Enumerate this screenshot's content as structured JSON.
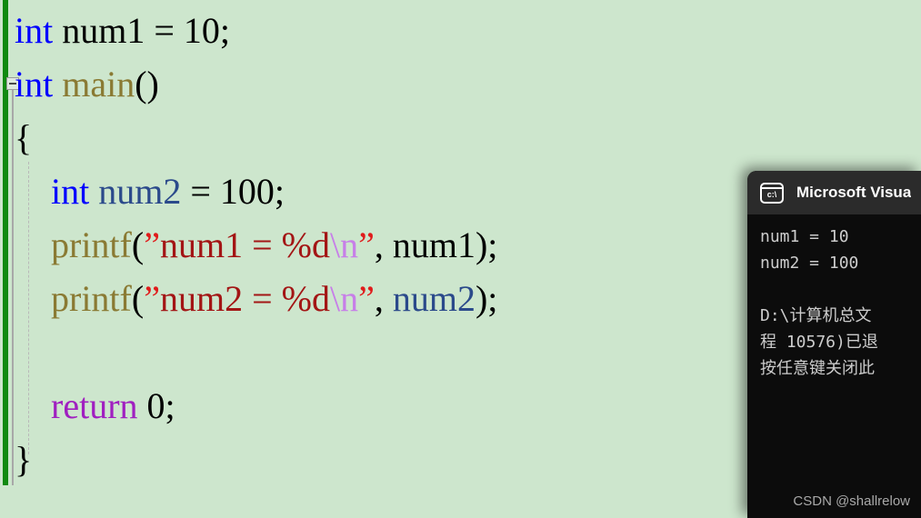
{
  "editor": {
    "background_color": "#cde6cd",
    "change_bar_color": "#108a10",
    "collapse_box": "collapse-outlining-box",
    "code_lines": [
      {
        "index": 1,
        "text": "int num1 = 10;",
        "tokens": [
          {
            "t": "int",
            "c": "kw"
          },
          {
            "t": " num1 = 10;",
            "c": "plain"
          }
        ]
      },
      {
        "index": 2,
        "text": "int main()",
        "tokens": [
          {
            "t": "int",
            "c": "kw"
          },
          {
            "t": " ",
            "c": "plain"
          },
          {
            "t": "main",
            "c": "fn"
          },
          {
            "t": "()",
            "c": "plain"
          }
        ]
      },
      {
        "index": 3,
        "text": "{",
        "tokens": [
          {
            "t": "{",
            "c": "plain"
          }
        ]
      },
      {
        "index": 4,
        "text": "    int num2 = 100;",
        "tokens": [
          {
            "t": "    ",
            "c": "plain"
          },
          {
            "t": "int",
            "c": "kw"
          },
          {
            "t": " ",
            "c": "plain"
          },
          {
            "t": "num2",
            "c": "local"
          },
          {
            "t": " = 100;",
            "c": "plain"
          }
        ]
      },
      {
        "index": 5,
        "text": "    printf(“num1 = %d\\n”, num1);",
        "tokens": [
          {
            "t": "    ",
            "c": "plain"
          },
          {
            "t": "printf",
            "c": "fn"
          },
          {
            "t": "(",
            "c": "plain"
          },
          {
            "t": "”",
            "c": "strq"
          },
          {
            "t": "num1 = %d",
            "c": "str"
          },
          {
            "t": "\\n",
            "c": "esc"
          },
          {
            "t": "”",
            "c": "strq"
          },
          {
            "t": ", ",
            "c": "plain"
          },
          {
            "t": "num1",
            "c": "plain"
          },
          {
            "t": ");",
            "c": "plain"
          }
        ]
      },
      {
        "index": 6,
        "text": "    printf(“num2 = %d\\n”, num2);",
        "tokens": [
          {
            "t": "    ",
            "c": "plain"
          },
          {
            "t": "printf",
            "c": "fn"
          },
          {
            "t": "(",
            "c": "plain"
          },
          {
            "t": "”",
            "c": "strq"
          },
          {
            "t": "num2 = %d",
            "c": "str"
          },
          {
            "t": "\\n",
            "c": "esc"
          },
          {
            "t": "”",
            "c": "strq"
          },
          {
            "t": ", ",
            "c": "plain"
          },
          {
            "t": "num2",
            "c": "local"
          },
          {
            "t": ");",
            "c": "plain"
          }
        ]
      },
      {
        "index": 7,
        "text": "",
        "tokens": []
      },
      {
        "index": 8,
        "text": "    return 0;",
        "tokens": [
          {
            "t": "    ",
            "c": "plain"
          },
          {
            "t": "return",
            "c": "ctrl"
          },
          {
            "t": " 0;",
            "c": "plain"
          }
        ]
      },
      {
        "index": 9,
        "text": "}",
        "tokens": [
          {
            "t": "}",
            "c": "plain"
          }
        ]
      }
    ]
  },
  "console": {
    "icon_label": "c:\\",
    "icon_name": "command-prompt-icon",
    "title": "Microsoft Visua",
    "title_full_hint": "Microsoft Visual Studio 调试控制台",
    "background_color": "#0c0c0c",
    "titlebar_color": "#2b2b2b",
    "output_lines": [
      "num1 = 10",
      "num2 = 100",
      "",
      "D:\\计算机总文",
      "程 10576)已退",
      "按任意键关闭此"
    ]
  },
  "watermark": {
    "text": "CSDN @shallrelow"
  }
}
